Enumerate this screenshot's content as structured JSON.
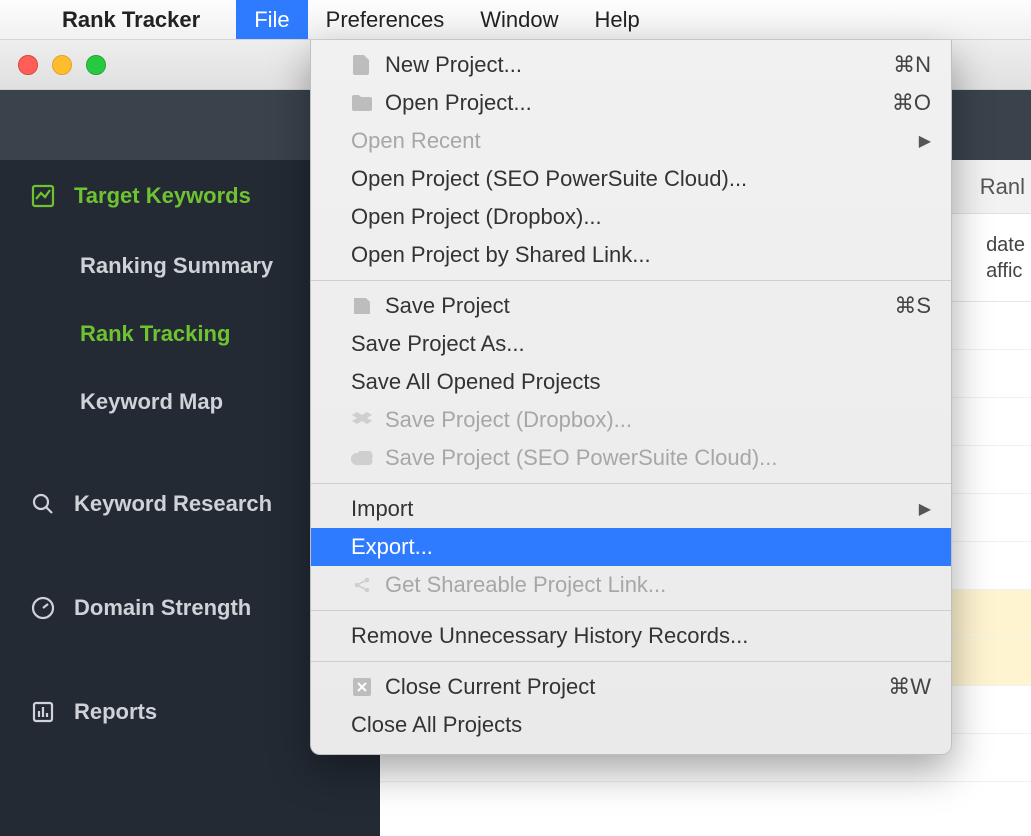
{
  "menubar": {
    "app_name": "Rank Tracker",
    "items": [
      {
        "label": "File",
        "active": true
      },
      {
        "label": "Preferences",
        "active": false
      },
      {
        "label": "Window",
        "active": false
      },
      {
        "label": "Help",
        "active": false
      }
    ]
  },
  "sidebar": {
    "target_keywords": "Target Keywords",
    "ranking_summary": "Ranking Summary",
    "rank_tracking": "Rank Tracking",
    "keyword_map": "Keyword Map",
    "keyword_research": "Keyword Research",
    "domain_strength": "Domain Strength",
    "reports": "Reports"
  },
  "content": {
    "toolbar_tab": "Ranl",
    "filter_line1": "date",
    "filter_line2": "affic"
  },
  "file_menu": {
    "new_project": {
      "label": "New Project...",
      "shortcut": "⌘N"
    },
    "open_project": {
      "label": "Open Project...",
      "shortcut": "⌘O"
    },
    "open_recent": {
      "label": "Open Recent"
    },
    "open_cloud": {
      "label": "Open Project (SEO PowerSuite Cloud)..."
    },
    "open_dropbox": {
      "label": "Open Project (Dropbox)..."
    },
    "open_shared": {
      "label": "Open Project by Shared Link..."
    },
    "save": {
      "label": "Save Project",
      "shortcut": "⌘S"
    },
    "save_as": {
      "label": "Save Project As..."
    },
    "save_all": {
      "label": "Save All Opened Projects"
    },
    "save_dropbox": {
      "label": "Save Project (Dropbox)..."
    },
    "save_cloud": {
      "label": "Save Project (SEO PowerSuite Cloud)..."
    },
    "import": {
      "label": "Import"
    },
    "export": {
      "label": "Export..."
    },
    "get_link": {
      "label": "Get Shareable Project Link..."
    },
    "remove_history": {
      "label": "Remove Unnecessary History Records..."
    },
    "close_current": {
      "label": "Close Current Project",
      "shortcut": "⌘W"
    },
    "close_all": {
      "label": "Close All Projects"
    }
  }
}
